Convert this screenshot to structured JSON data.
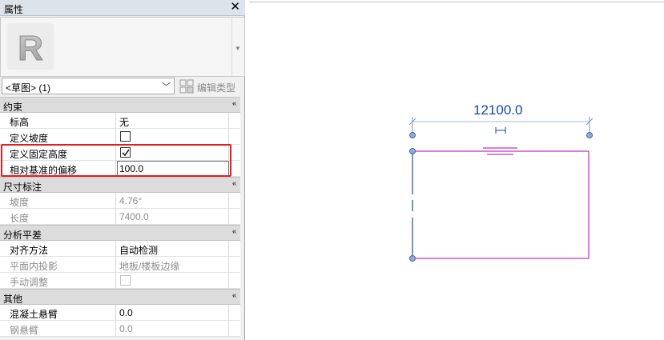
{
  "panel": {
    "title": "属性",
    "close_label": "✕",
    "family_letter": "R",
    "selector_value": "<草图> (1)",
    "edit_type_label": "编辑类型"
  },
  "categories": {
    "constraints": "约束",
    "dimensions": "尺寸标注",
    "analytical": "分析平差",
    "other": "其他",
    "collapse": "«"
  },
  "rows": {
    "level": {
      "label": "标高",
      "value": "无"
    },
    "define_slope": {
      "label": "定义坡度",
      "checked": false
    },
    "define_fixed_height": {
      "label": "定义固定高度",
      "checked": true
    },
    "offset_from_base": {
      "label": "相对基准的偏移",
      "value": "100.0"
    },
    "slope": {
      "label": "坡度",
      "value": "4.76°"
    },
    "length": {
      "label": "长度",
      "value": "7400.0"
    },
    "alignment_method": {
      "label": "对齐方法",
      "value": "自动检测"
    },
    "plan_projection": {
      "label": "平面内投影",
      "value": "地板/楼板边缘"
    },
    "manual_adjust": {
      "label": "手动调整",
      "checked": false
    },
    "concrete_cantilever": {
      "label": "混凝土悬臂",
      "value": "0.0"
    },
    "steel_cantilever": {
      "label": "钢悬臂",
      "value": "0.0"
    }
  },
  "canvas": {
    "dimension_value": "12100.0",
    "sketch_color": "#b000b0",
    "dimension_color": "#1346a8"
  }
}
